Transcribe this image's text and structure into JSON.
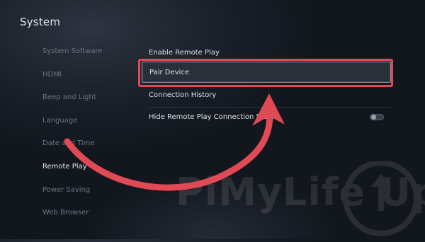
{
  "header": {
    "title": "System"
  },
  "sidebar": {
    "items": [
      {
        "label": "System Software"
      },
      {
        "label": "HDMI"
      },
      {
        "label": "Beep and Light"
      },
      {
        "label": "Language"
      },
      {
        "label": "Date and Time"
      },
      {
        "label": "Remote Play",
        "active": true
      },
      {
        "label": "Power Saving"
      },
      {
        "label": "Web Browser"
      }
    ]
  },
  "main": {
    "rows": [
      {
        "label": "Enable Remote Play"
      },
      {
        "label": "Pair Device",
        "selected": true
      },
      {
        "label": "Connection History"
      },
      {
        "label": "Hide Remote Play Connection Status",
        "toggle": "off"
      }
    ]
  },
  "annotation": {
    "highlight_color": "#e04a55",
    "arrow_color": "#e04a55"
  },
  "watermark": {
    "text": "PiMyLife Up"
  }
}
